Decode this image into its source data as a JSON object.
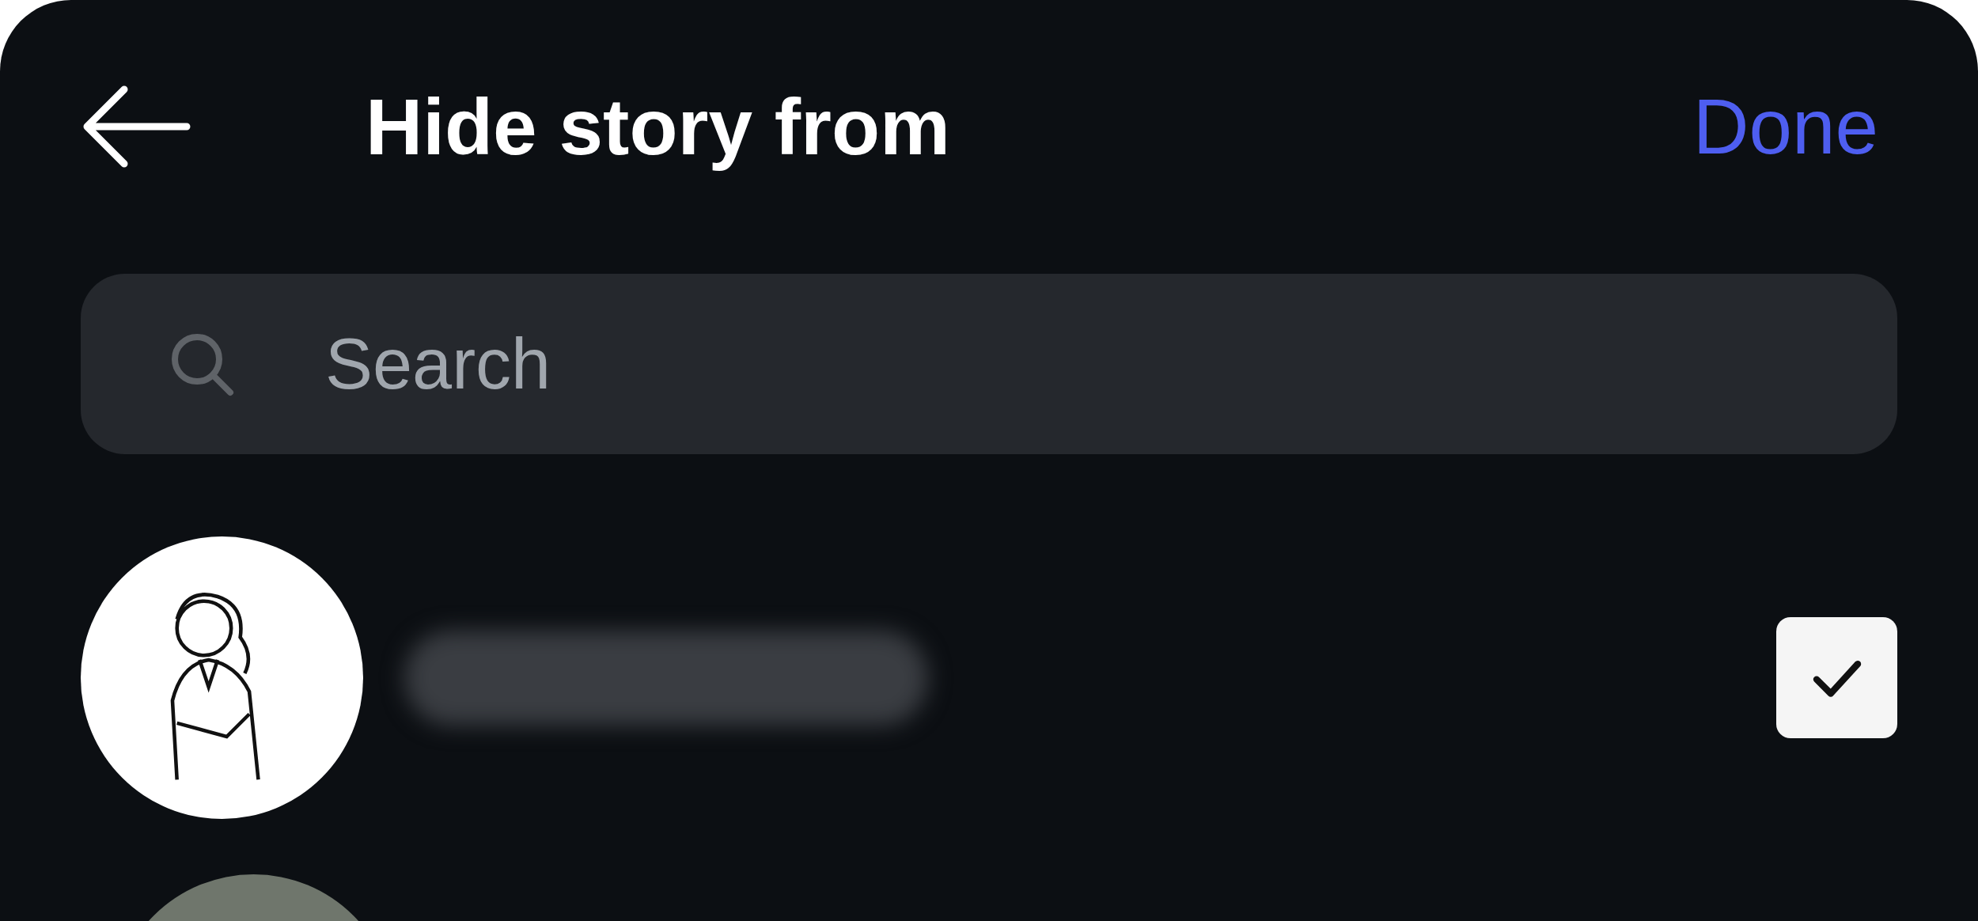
{
  "header": {
    "title": "Hide story from",
    "done": "Done"
  },
  "search": {
    "placeholder": "Search"
  },
  "rows": [
    {
      "kind": "full",
      "checked": true
    },
    {
      "kind": "cut"
    }
  ]
}
